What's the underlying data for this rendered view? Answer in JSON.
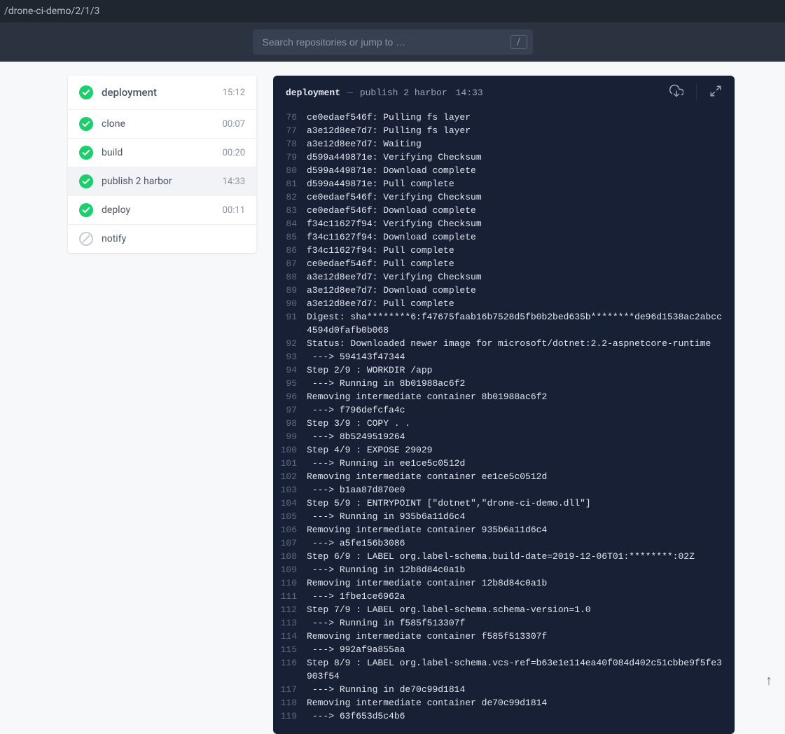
{
  "breadcrumb": "/drone-ci-demo/2/1/3",
  "search": {
    "placeholder": "Search repositories or jump to …",
    "slash": "/"
  },
  "pipeline": {
    "name": "deployment",
    "total_time": "15:12",
    "steps": [
      {
        "name": "clone",
        "time": "00:07",
        "status": "success",
        "selected": false
      },
      {
        "name": "build",
        "time": "00:20",
        "status": "success",
        "selected": false
      },
      {
        "name": "publish 2 harbor",
        "time": "14:33",
        "status": "success",
        "selected": true
      },
      {
        "name": "deploy",
        "time": "00:11",
        "status": "success",
        "selected": false
      },
      {
        "name": "notify",
        "time": "",
        "status": "skipped",
        "selected": false
      }
    ]
  },
  "log_header": {
    "stage": "deployment",
    "step": "publish 2 harbor",
    "time": "14:33"
  },
  "log": {
    "start": 76,
    "lines": [
      "ce0edaef546f: Pulling fs layer",
      "a3e12d8ee7d7: Pulling fs layer",
      "a3e12d8ee7d7: Waiting",
      "d599a449871e: Verifying Checksum",
      "d599a449871e: Download complete",
      "d599a449871e: Pull complete",
      "ce0edaef546f: Verifying Checksum",
      "ce0edaef546f: Download complete",
      "f34c11627f94: Verifying Checksum",
      "f34c11627f94: Download complete",
      "f34c11627f94: Pull complete",
      "ce0edaef546f: Pull complete",
      "a3e12d8ee7d7: Verifying Checksum",
      "a3e12d8ee7d7: Download complete",
      "a3e12d8ee7d7: Pull complete",
      "Digest: sha********6:f47675faab16b7528d5fb0b2bed635b********de96d1538ac2abcc4594d0fafb0b068",
      "Status: Downloaded newer image for microsoft/dotnet:2.2-aspnetcore-runtime",
      " ---> 594143f47344",
      "Step 2/9 : WORKDIR /app",
      " ---> Running in 8b01988ac6f2",
      "Removing intermediate container 8b01988ac6f2",
      " ---> f796defcfa4c",
      "Step 3/9 : COPY . .",
      " ---> 8b5249519264",
      "Step 4/9 : EXPOSE 29029",
      " ---> Running in ee1ce5c0512d",
      "Removing intermediate container ee1ce5c0512d",
      " ---> b1aa87d870e0",
      "Step 5/9 : ENTRYPOINT [\"dotnet\",\"drone-ci-demo.dll\"]",
      " ---> Running in 935b6a11d6c4",
      "Removing intermediate container 935b6a11d6c4",
      " ---> a5fe156b3086",
      "Step 6/9 : LABEL org.label-schema.build-date=2019-12-06T01:********:02Z",
      " ---> Running in 12b8d84c0a1b",
      "Removing intermediate container 12b8d84c0a1b",
      " ---> 1fbe1ce6962a",
      "Step 7/9 : LABEL org.label-schema.schema-version=1.0",
      " ---> Running in f585f513307f",
      "Removing intermediate container f585f513307f",
      " ---> 992af9a855aa",
      "Step 8/9 : LABEL org.label-schema.vcs-ref=b63e1e114ea40f084d402c51cbbe9f5fe3903f54",
      " ---> Running in de70c99d1814",
      "Removing intermediate container de70c99d1814",
      " ---> 63f653d5c4b6"
    ]
  },
  "icons": {
    "download": "⭳",
    "expand": "⤢",
    "arrow_up": "↑"
  }
}
